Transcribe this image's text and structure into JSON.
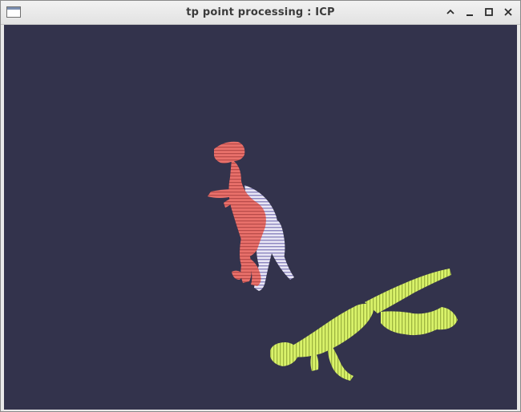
{
  "window": {
    "title": "tp point processing : ICP",
    "icons": {
      "app": "window-icon",
      "minimize_up": "chevron-up-icon",
      "minimize": "minimize-icon",
      "maximize": "maximize-icon",
      "close": "close-icon"
    }
  },
  "viewport": {
    "background": "#33334c",
    "models": [
      {
        "name": "red-dinosaur",
        "color": "#e8706a"
      },
      {
        "name": "white-dinosaur",
        "color": "#e8e6f5"
      },
      {
        "name": "green-dinosaur",
        "color": "#d9f26a"
      }
    ]
  }
}
